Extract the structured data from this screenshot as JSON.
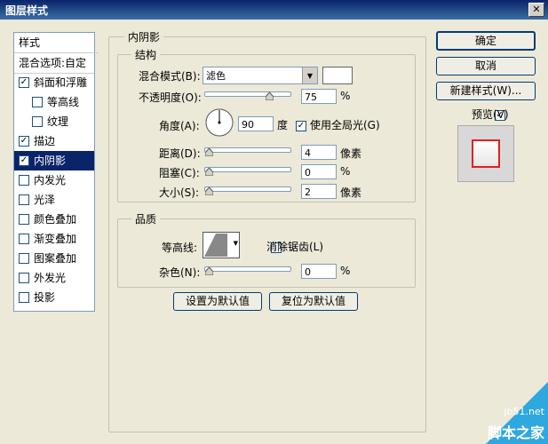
{
  "window": {
    "title": "图层样式",
    "close_glyph": "✕"
  },
  "sidebar": {
    "header": "样式",
    "blend_options": "混合选项:自定",
    "items": [
      {
        "label": "斜面和浮雕",
        "checked": true
      },
      {
        "label": "等高线",
        "checked": false
      },
      {
        "label": "纹理",
        "checked": false
      },
      {
        "label": "描边",
        "checked": true
      },
      {
        "label": "内阴影",
        "checked": true
      },
      {
        "label": "内发光",
        "checked": false
      },
      {
        "label": "光泽",
        "checked": false
      },
      {
        "label": "颜色叠加",
        "checked": false
      },
      {
        "label": "渐变叠加",
        "checked": false
      },
      {
        "label": "图案叠加",
        "checked": false
      },
      {
        "label": "外发光",
        "checked": false
      },
      {
        "label": "投影",
        "checked": false
      }
    ],
    "check_glyph": "✓"
  },
  "inner_shadow": {
    "title": "内阴影",
    "structure": {
      "title": "结构",
      "blend_mode_label": "混合模式(B):",
      "blend_mode_value": "滤色",
      "opacity_label": "不透明度(O):",
      "opacity_value": "75",
      "opacity_unit": "%",
      "angle_label": "角度(A):",
      "angle_value": "90",
      "angle_unit": "度",
      "global_light_label": "使用全局光(G)",
      "global_light_checked": true,
      "distance_label": "距离(D):",
      "distance_value": "4",
      "distance_unit": "像素",
      "choke_label": "阻塞(C):",
      "choke_value": "0",
      "choke_unit": "%",
      "size_label": "大小(S):",
      "size_value": "2",
      "size_unit": "像素"
    },
    "quality": {
      "title": "品质",
      "contour_label": "等高线:",
      "anti_alias_label": "消除锯齿(L)",
      "anti_alias_checked": false,
      "noise_label": "杂色(N):",
      "noise_value": "0",
      "noise_unit": "%"
    },
    "set_default_label": "设置为默认值",
    "reset_default_label": "复位为默认值"
  },
  "actions": {
    "ok_label": "确定",
    "cancel_label": "取消",
    "new_style_label": "新建样式(W)...",
    "preview_label": "预览(V)",
    "preview_checked": true
  },
  "watermark": {
    "site": "jb51.net",
    "name": "脚本之家"
  },
  "colors": {
    "title_bar": "#0a246a",
    "selected": "#0a246a",
    "preview_stroke": "#e02020"
  }
}
